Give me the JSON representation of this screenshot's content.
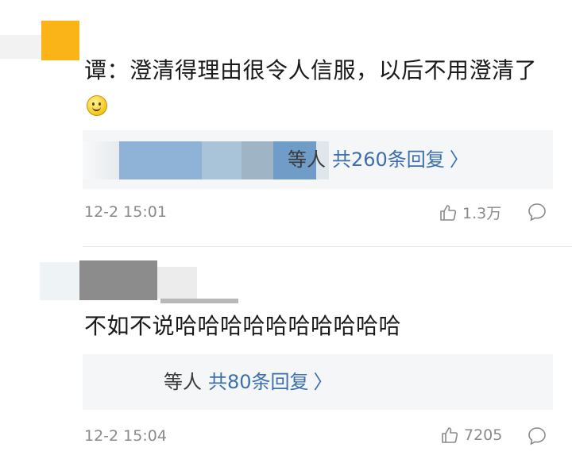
{
  "comments": [
    {
      "text": "谭：澄清得理由很令人信服，以后不用澄清了",
      "reply_names": "等人",
      "reply_count": "共260条回复",
      "reply_chevron": "〉",
      "time": "12-2 15:01",
      "likes": "1.3万",
      "avatar_color": "#fbb417"
    },
    {
      "text": "不如不说哈哈哈哈哈哈哈哈哈哈",
      "reply_names": "等人",
      "reply_count": "共80条回复",
      "reply_chevron": "〉",
      "time": "12-2 15:04",
      "likes": "7205",
      "avatar_color": "#8c8c8c"
    }
  ],
  "colors": {
    "link": "#3b6fb0",
    "meta": "#8a8a8a",
    "reply_bg": "#f5f6f7"
  },
  "icons": {
    "like": "thumbs-up-icon",
    "reply": "comment-bubble-icon",
    "emoji": "smiley-emoji-icon"
  }
}
